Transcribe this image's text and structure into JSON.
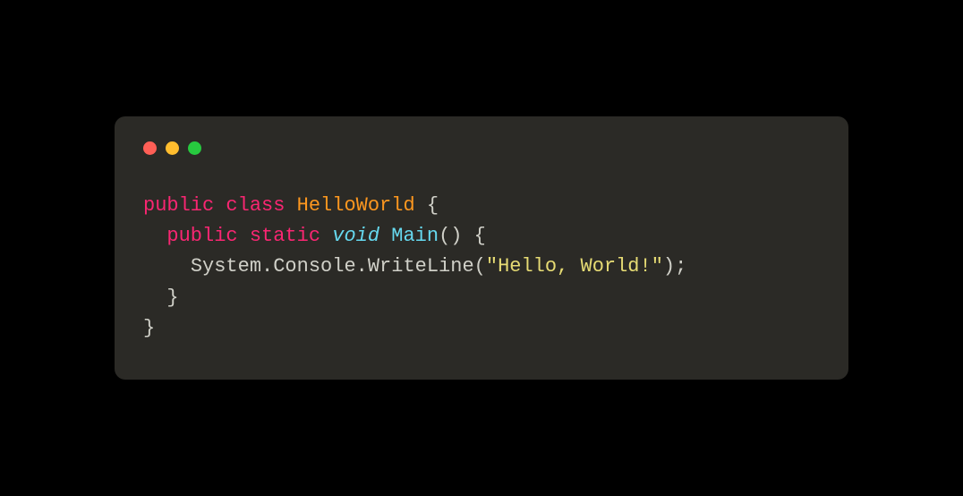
{
  "colors": {
    "background": "#000000",
    "window": "#2b2a26",
    "red": "#ff5f56",
    "yellow": "#ffbd2e",
    "green": "#27c93f",
    "keyword": "#f92672",
    "type": "#66d9ef",
    "classname": "#fd971f",
    "string": "#e6db74",
    "default": "#d0d0c8"
  },
  "code": {
    "tokens": [
      [
        {
          "t": "public",
          "c": "kw"
        },
        {
          "t": " ",
          "c": "punct"
        },
        {
          "t": "class",
          "c": "kw"
        },
        {
          "t": " ",
          "c": "punct"
        },
        {
          "t": "HelloWorld",
          "c": "classname"
        },
        {
          "t": " {",
          "c": "punct"
        }
      ],
      [
        {
          "t": "  ",
          "c": "punct"
        },
        {
          "t": "public",
          "c": "kw"
        },
        {
          "t": " ",
          "c": "punct"
        },
        {
          "t": "static",
          "c": "kw"
        },
        {
          "t": " ",
          "c": "punct"
        },
        {
          "t": "void",
          "c": "type"
        },
        {
          "t": " ",
          "c": "punct"
        },
        {
          "t": "Main",
          "c": "method"
        },
        {
          "t": "() {",
          "c": "punct"
        }
      ],
      [
        {
          "t": "    ",
          "c": "punct"
        },
        {
          "t": "System.Console.WriteLine",
          "c": "obj"
        },
        {
          "t": "(",
          "c": "punct"
        },
        {
          "t": "\"Hello, World!\"",
          "c": "str"
        },
        {
          "t": ");",
          "c": "punct"
        }
      ],
      [
        {
          "t": "  }",
          "c": "punct"
        }
      ],
      [
        {
          "t": "}",
          "c": "punct"
        }
      ]
    ]
  }
}
